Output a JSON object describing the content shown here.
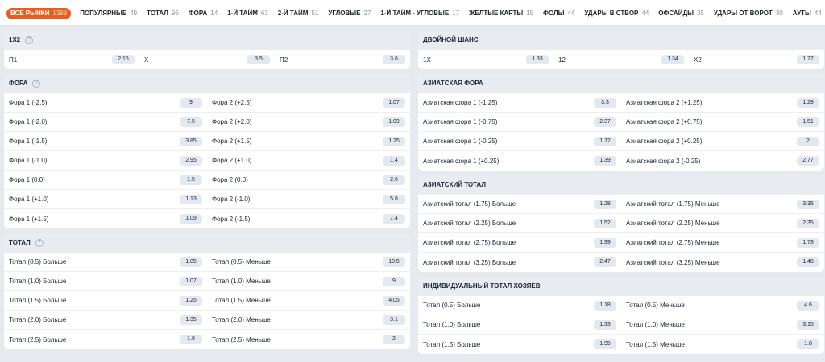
{
  "tabs": [
    {
      "label": "ВСЕ РЫНКИ",
      "count": "1398"
    },
    {
      "label": "ПОПУЛЯРНЫЕ",
      "count": "49"
    },
    {
      "label": "ТОТАЛ",
      "count": "96"
    },
    {
      "label": "ФОРА",
      "count": "14"
    },
    {
      "label": "1-Й ТАЙМ",
      "count": "63"
    },
    {
      "label": "2-Й ТАЙМ",
      "count": "51"
    },
    {
      "label": "УГЛОВЫЕ",
      "count": "27"
    },
    {
      "label": "1-Й ТАЙМ - УГЛОВЫЕ",
      "count": "17"
    },
    {
      "label": "ЖЁЛТЫЕ КАРТЫ",
      "count": "15"
    },
    {
      "label": "ФОЛЫ",
      "count": "44"
    },
    {
      "label": "УДАРЫ В СТВОР",
      "count": "44"
    },
    {
      "label": "ОФСАЙДЫ",
      "count": "35"
    },
    {
      "label": "УДАРЫ ОТ ВОРОТ",
      "count": "30"
    },
    {
      "label": "АУТЫ",
      "count": "44"
    }
  ],
  "left": [
    {
      "title": "1X2",
      "info": "?",
      "rows": [
        [
          {
            "l": "П1",
            "o": "2.15"
          },
          {
            "l": "X",
            "o": "3.5"
          },
          {
            "l": "П2",
            "o": "3.6"
          }
        ]
      ]
    },
    {
      "title": "ФОРА",
      "info": "?",
      "rows": [
        [
          {
            "l": "Фора 1 (-2.5)",
            "o": "9"
          },
          {
            "l": "Фора 2 (+2.5)",
            "o": "1.07"
          }
        ],
        [
          {
            "l": "Фора 1 (-2.0)",
            "o": "7.5"
          },
          {
            "l": "Фора 2 (+2.0)",
            "o": "1.09"
          }
        ],
        [
          {
            "l": "Фора 1 (-1.5)",
            "o": "3.85"
          },
          {
            "l": "Фора 2 (+1.5)",
            "o": "1.25"
          }
        ],
        [
          {
            "l": "Фора 1 (-1.0)",
            "o": "2.95"
          },
          {
            "l": "Фора 2 (+1.0)",
            "o": "1.4"
          }
        ],
        [
          {
            "l": "Фора 1 (0.0)",
            "o": "1.5"
          },
          {
            "l": "Фора 2 (0.0)",
            "o": "2.6"
          }
        ],
        [
          {
            "l": "Фора 1 (+1.0)",
            "o": "1.13"
          },
          {
            "l": "Фора 2 (-1.0)",
            "o": "5.8"
          }
        ],
        [
          {
            "l": "Фора 1 (+1.5)",
            "o": "1.09"
          },
          {
            "l": "Фора 2 (-1.5)",
            "o": "7.4"
          }
        ]
      ]
    },
    {
      "title": "ТОТАЛ",
      "info": "?",
      "rows": [
        [
          {
            "l": "Тотал (0.5) Больше",
            "o": "1.05"
          },
          {
            "l": "Тотал (0.5) Меньше",
            "o": "10.5"
          }
        ],
        [
          {
            "l": "Тотал (1.0) Больше",
            "o": "1.07"
          },
          {
            "l": "Тотал (1.0) Меньше",
            "o": "9"
          }
        ],
        [
          {
            "l": "Тотал (1.5) Больше",
            "o": "1.25"
          },
          {
            "l": "Тотал (1.5) Меньше",
            "o": "4.05"
          }
        ],
        [
          {
            "l": "Тотал (2.0) Больше",
            "o": "1.35"
          },
          {
            "l": "Тотал (2.0) Меньше",
            "o": "3.1"
          }
        ],
        [
          {
            "l": "Тотал (2.5) Больше",
            "o": "1.8"
          },
          {
            "l": "Тотал (2.5) Меньше",
            "o": "2"
          }
        ]
      ]
    }
  ],
  "right": [
    {
      "title": "ДВОЙНОЙ ШАНС",
      "info": "",
      "rows": [
        [
          {
            "l": "1X",
            "o": "1.33"
          },
          {
            "l": "12",
            "o": "1.34"
          },
          {
            "l": "X2",
            "o": "1.77"
          }
        ]
      ]
    },
    {
      "title": "АЗИАТСКАЯ ФОРА",
      "info": "",
      "rows": [
        [
          {
            "l": "Азиатская фора 1 (-1.25)",
            "o": "3.3"
          },
          {
            "l": "Азиатская фора 2 (+1.25)",
            "o": "1.29"
          }
        ],
        [
          {
            "l": "Азиатская фора 1 (-0.75)",
            "o": "2.37"
          },
          {
            "l": "Азиатская фора 2 (+0.75)",
            "o": "1.51"
          }
        ],
        [
          {
            "l": "Азиатская фора 1 (-0.25)",
            "o": "1.72"
          },
          {
            "l": "Азиатская фора 2 (+0.25)",
            "o": "2"
          }
        ],
        [
          {
            "l": "Азиатская фора 1 (+0.25)",
            "o": "1.39"
          },
          {
            "l": "Азиатская фора 2 (-0.25)",
            "o": "2.77"
          }
        ]
      ]
    },
    {
      "title": "АЗИАТСКИЙ ТОТАЛ",
      "info": "",
      "rows": [
        [
          {
            "l": "Азиатский тотал (1.75) Больше",
            "o": "1.28"
          },
          {
            "l": "Азиатский тотал (1.75) Меньше",
            "o": "3.35"
          }
        ],
        [
          {
            "l": "Азиатский тотал (2.25) Больше",
            "o": "1.52"
          },
          {
            "l": "Азиатский тотал (2.25) Меньше",
            "o": "2.35"
          }
        ],
        [
          {
            "l": "Азиатский тотал (2.75) Больше",
            "o": "1.99"
          },
          {
            "l": "Азиатский тотал (2.75) Меньше",
            "o": "1.73"
          }
        ],
        [
          {
            "l": "Азиатский тотал (3.25) Больше",
            "o": "2.47"
          },
          {
            "l": "Азиатский тотал (3.25) Меньше",
            "o": "1.48"
          }
        ]
      ]
    },
    {
      "title": "ИНДИВИДУАЛЬНЫЙ ТОТАЛ ХОЗЯЕВ",
      "info": "",
      "rows": [
        [
          {
            "l": "Тотал (0.5) Больше",
            "o": "1.18"
          },
          {
            "l": "Тотал (0.5) Меньше",
            "o": "4.6"
          }
        ],
        [
          {
            "l": "Тотал (1.0) Больше",
            "o": "1.33"
          },
          {
            "l": "Тотал (1.0) Меньше",
            "o": "3.15"
          }
        ],
        [
          {
            "l": "Тотал (1.5) Больше",
            "o": "1.95"
          },
          {
            "l": "Тотал (1.5) Меньше",
            "o": "1.8"
          }
        ]
      ]
    }
  ]
}
